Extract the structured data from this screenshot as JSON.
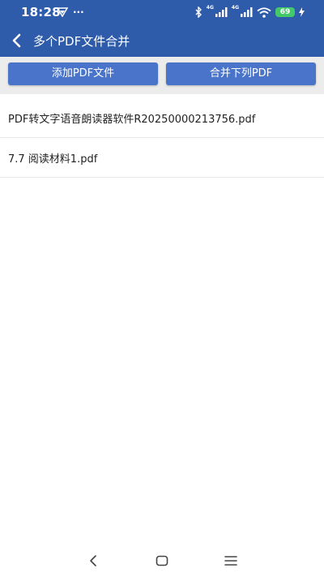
{
  "status_bar": {
    "time": "18:28",
    "more": "···",
    "net_label_1": "4G",
    "net_label_2": "4G",
    "battery": "69"
  },
  "header": {
    "title": "多个PDF文件合并"
  },
  "actions": {
    "add_label": "添加PDF文件",
    "merge_label": "合并下列PDF"
  },
  "files": [
    {
      "name": "PDF转文字语音朗读器软件R20250000213756.pdf"
    },
    {
      "name": "7.7 阅读材料1.pdf"
    }
  ],
  "colors": {
    "header": "#2e5cab",
    "button": "#4a74c9",
    "battery": "#43c86a"
  },
  "icons": {
    "status": [
      "vpn-icon",
      "bluetooth-icon",
      "signal-icon",
      "wifi-icon",
      "charging-icon"
    ],
    "nav": [
      "nav-back-icon",
      "nav-home-icon",
      "nav-menu-icon"
    ]
  }
}
